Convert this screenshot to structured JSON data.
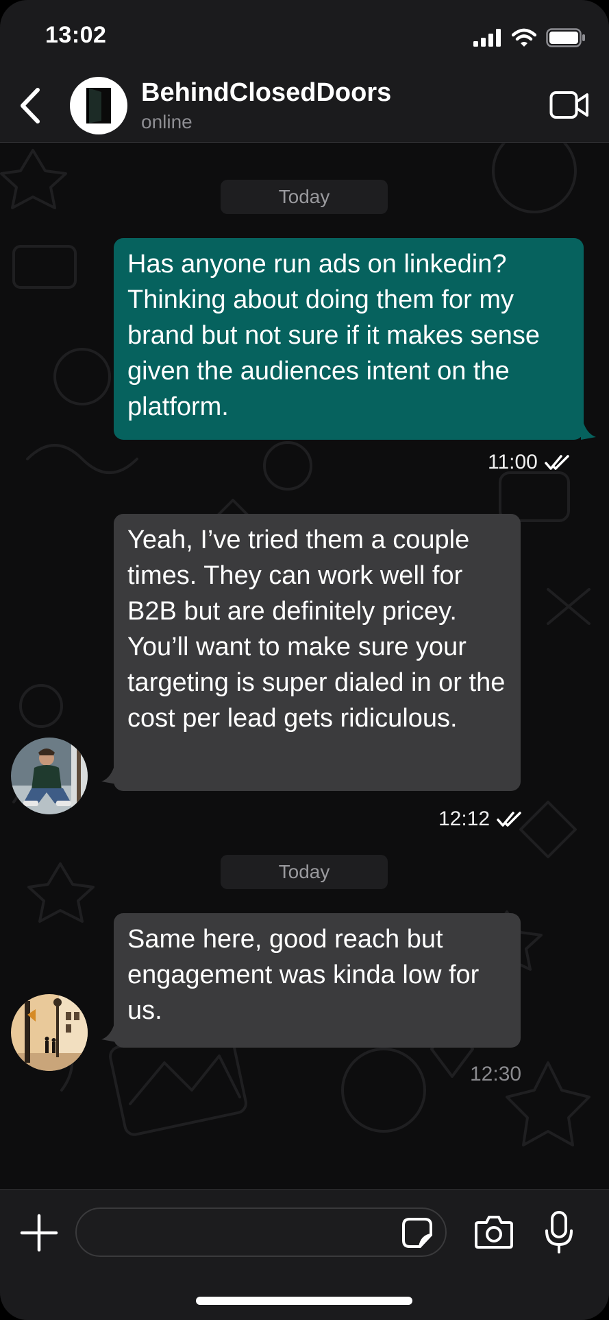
{
  "status_bar": {
    "time": "13:02",
    "icons": [
      "signal-icon",
      "wifi-icon",
      "battery-icon"
    ]
  },
  "header": {
    "back_icon": "chevron-left-icon",
    "chat_name": "BehindClosedDoors",
    "chat_status": "online",
    "video_icon": "video-camera-icon"
  },
  "messages": [
    {
      "type": "day",
      "label": "Today"
    },
    {
      "type": "outgoing",
      "text": "Has anyone run ads on linkedin? Thinking about doing them for my brand but not sure if it makes sense given the audiences intent on the platform.",
      "time": "11:00",
      "status": "read"
    },
    {
      "type": "incoming",
      "text": "Yeah, I’ve tried them a couple times. They can work well for B2B but are definitely pricey. You’ll want to make sure your targeting is super dialed in or the cost per lead gets ridiculous.",
      "time": "12:12",
      "status": "read"
    },
    {
      "type": "day",
      "label": "Today"
    },
    {
      "type": "incoming",
      "text": "Same here, good reach but engagement was kinda low for us.",
      "time": "12:30"
    }
  ],
  "input_bar": {
    "placeholder": "",
    "icons": [
      "plus-icon",
      "sticker-icon",
      "camera-icon",
      "microphone-icon"
    ]
  },
  "colors": {
    "outgoing_bubble": "#06625e",
    "incoming_bubble": "#3b3b3d",
    "background": "#0d0d0e",
    "bars": "#1b1b1d"
  }
}
